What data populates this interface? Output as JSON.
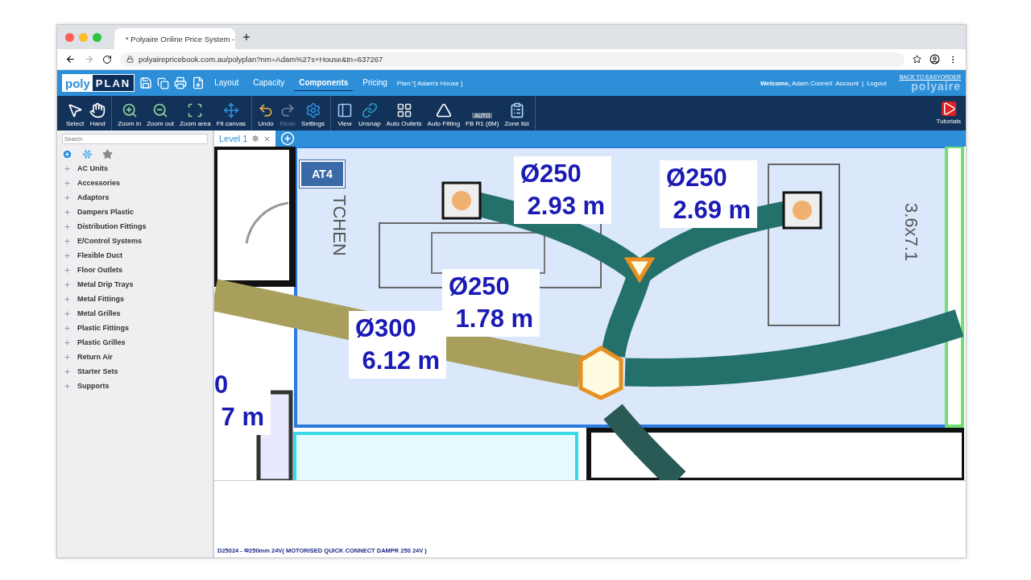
{
  "browser": {
    "tab_title": "* Polyaire Online Price System -",
    "url": "polyairepricebook.com.au/polyplan?nm=Adam%27s+House&tn=637267"
  },
  "header": {
    "logo_left": "poly",
    "logo_right": "PLAN",
    "nav": [
      {
        "label": "Layout",
        "selected": false
      },
      {
        "label": "Capacity",
        "selected": false
      },
      {
        "label": "Components",
        "selected": true
      },
      {
        "label": "Pricing",
        "selected": false
      }
    ],
    "plan": "Plan:\"[ Adam's House ]",
    "welcome": "**Welcome,** Adam Connell",
    "account": "Account",
    "separator": "|",
    "logout": "Logout",
    "back_link": "BACK TO EASYORDER",
    "brand": "polyaire"
  },
  "toolbar": {
    "groups": [
      [
        {
          "label": "Select",
          "disabled": false
        },
        {
          "label": "Hand",
          "disabled": false
        }
      ],
      [
        {
          "label": "Zoom in",
          "disabled": false
        },
        {
          "label": "Zoom out",
          "disabled": false
        },
        {
          "label": "Zoom area",
          "disabled": false
        },
        {
          "label": "Fit canvas",
          "disabled": false
        }
      ],
      [
        {
          "label": "Undo",
          "disabled": false
        },
        {
          "label": "Redo",
          "disabled": true
        },
        {
          "label": "Settings",
          "disabled": false
        }
      ],
      [
        {
          "label": "View",
          "disabled": false
        },
        {
          "label": "Unsnap",
          "disabled": false
        },
        {
          "label": "Auto Outlets",
          "disabled": false
        },
        {
          "label": "Auto Fitting",
          "disabled": false
        },
        {
          "label": "FB R1 (6M)",
          "disabled": false,
          "badge": "AUTO"
        },
        {
          "label": "Zone list",
          "disabled": false
        }
      ]
    ],
    "tutorials": "Tutorials"
  },
  "sidebar": {
    "search": {
      "placeholder": "Search"
    },
    "items": [
      "AC Units",
      "Accessories",
      "Adaptors",
      "Dampers Plastic",
      "Distribution Fittings",
      "E/Control Systems",
      "Flexible Duct",
      "Floor Outlets",
      "Metal Drip Trays",
      "Metal Fittings",
      "Metal Grilles",
      "Plastic Fittings",
      "Plastic Grilles",
      "Return Air",
      "Starter Sets",
      "Supports"
    ]
  },
  "level_tabs": [
    {
      "label": "Level 1",
      "selected": true
    }
  ],
  "canvas": {
    "zone_badge": "AT4",
    "room_labels": [
      "TCHEN",
      "3.6x7.1"
    ],
    "duct_labels": [
      {
        "size": "Ø250",
        "length": "2.93 m"
      },
      {
        "size": "Ø250",
        "length": "2.69 m"
      },
      {
        "size": "Ø250",
        "length": "1.78 m"
      },
      {
        "size": "Ø300",
        "length": "6.12 m"
      },
      {
        "size": "0",
        "length": "7 m"
      }
    ]
  },
  "status": "D25024 - Φ250mm 24V( MOTORISED QUICK CONNECT DAMPR 250 24V )"
}
